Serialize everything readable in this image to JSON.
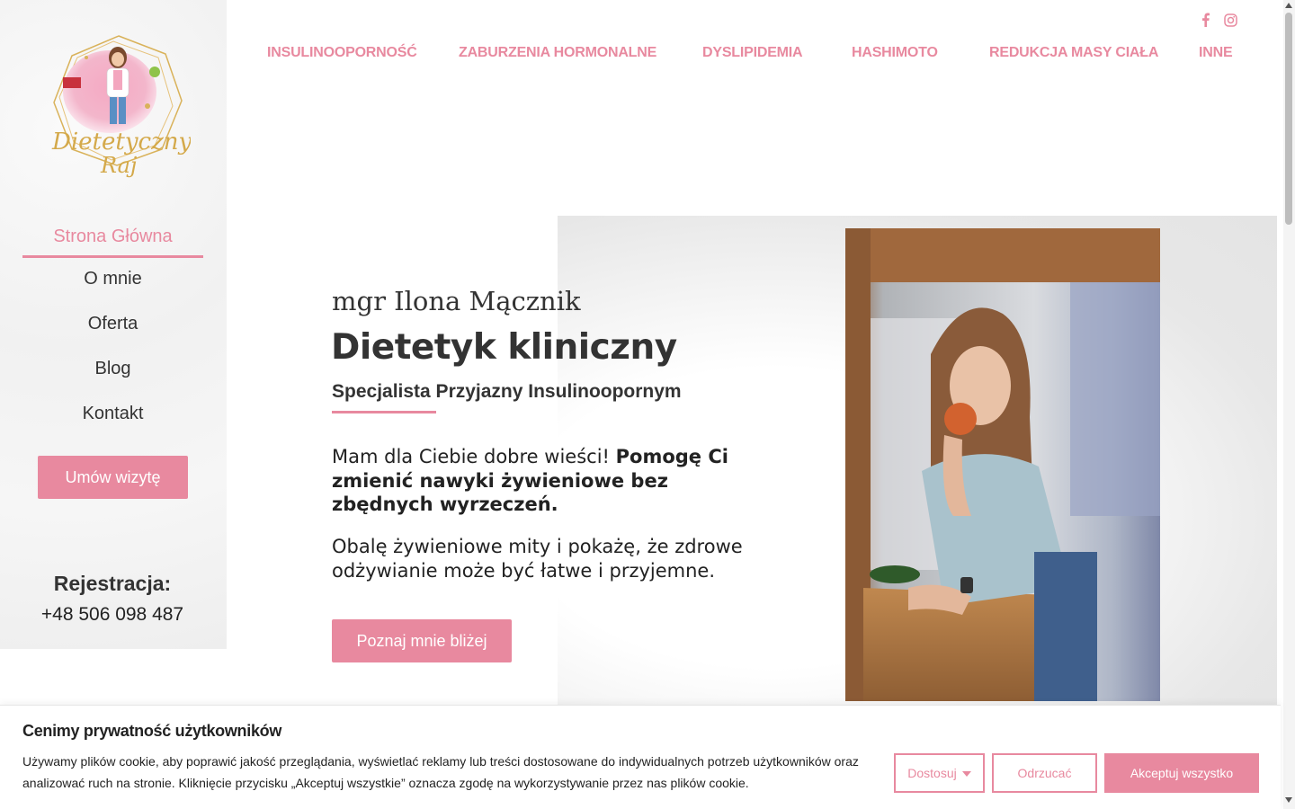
{
  "brand": {
    "logo_text": "Dietetyczny Raj",
    "accent_color": "#e8899f"
  },
  "sidebar": {
    "items": [
      {
        "label": "Strona Główna",
        "active": true
      },
      {
        "label": "O mnie"
      },
      {
        "label": "Oferta"
      },
      {
        "label": "Blog"
      },
      {
        "label": "Kontakt"
      }
    ],
    "cta_label": "Umów wizytę",
    "registration_label": "Rejestracja:",
    "phone": "+48 506 098 487"
  },
  "social": {
    "icons": [
      "facebook-icon",
      "instagram-icon"
    ]
  },
  "topnav": {
    "items": [
      {
        "label": "INSULINOOPORNOŚĆ"
      },
      {
        "label": "ZABURZENIA HORMONALNE"
      },
      {
        "label": "DYSLIPIDEMIA"
      },
      {
        "label": "HASHIMOTO"
      },
      {
        "label": "REDUKCJA MASY CIAŁA"
      },
      {
        "label": "INNE"
      }
    ]
  },
  "hero": {
    "name": "mgr Ilona Mącznik",
    "title": "Dietetyk kliniczny",
    "specialty": "Specjalista Przyjazny Insulinoopornym",
    "lead_plain": "Mam dla Ciebie dobre wieści! ",
    "lead_bold": "Pomogę Ci zmienić nawyki żywieniowe bez zbędnych wyrzeczeń.",
    "paragraph2": "Obalę żywieniowe mity i pokażę, że zdrowe odżywianie może być łatwe i przyjemne.",
    "cta_label": "Poznaj mnie bliżej"
  },
  "cookie": {
    "title": "Cenimy prywatność użytkowników",
    "text": "Używamy plików cookie, aby poprawić jakość przeglądania, wyświetlać reklamy lub treści dostosowane do indywidualnych potrzeb użytkowników oraz analizować ruch na stronie. Kliknięcie przycisku „Akceptuj wszystkie” oznacza zgodę na wykorzystywanie przez nas plików cookie.",
    "customize_label": "Dostosuj",
    "reject_label": "Odrzucać",
    "accept_label": "Akceptuj wszystko"
  }
}
